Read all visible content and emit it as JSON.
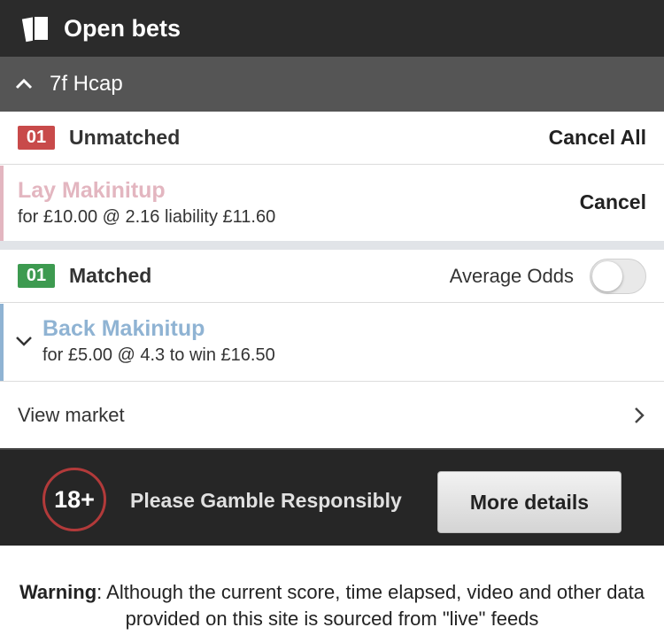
{
  "header": {
    "title": "Open bets",
    "icon": "betslip-icon"
  },
  "market": {
    "name": "7f Hcap",
    "icon": "chevron-up-icon"
  },
  "unmatched": {
    "count": "01",
    "label": "Unmatched",
    "cancel_all": "Cancel All",
    "badge_color": "#c84a4a",
    "bet": {
      "title": "Lay Makinitup",
      "detail": "for £10.00 @ 2.16 liability £11.60",
      "cancel": "Cancel",
      "accent": "#e3b6c0"
    }
  },
  "matched": {
    "count": "01",
    "label": "Matched",
    "average_odds_label": "Average Odds",
    "average_odds_on": false,
    "badge_color": "#3d9a50",
    "bet": {
      "title": "Back Makinitup",
      "detail": "for £5.00 @ 4.3 to win £16.50",
      "accent": "#8fb3d3"
    }
  },
  "view_market": {
    "label": "View market",
    "icon": "chevron-right-icon"
  },
  "footer": {
    "age": "18+",
    "message": "Please Gamble Responsibly",
    "more_details": "More details"
  },
  "warning": {
    "label": "Warning",
    "text": ": Although the current score, time elapsed, video and other data provided on this site is sourced from \"live\" feeds"
  }
}
